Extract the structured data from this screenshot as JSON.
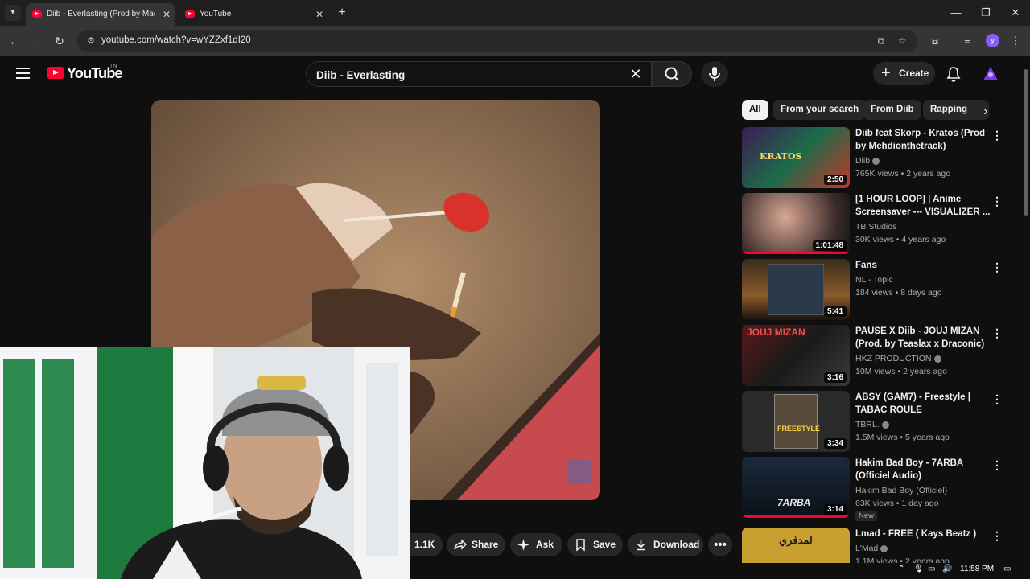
{
  "browser": {
    "tabs": [
      {
        "title": "Diib - Everlasting (Prod by Mac",
        "active": true
      },
      {
        "title": "YouTube",
        "active": false
      }
    ],
    "url": "youtube.com/watch?v=wYZZxf1dI20"
  },
  "header": {
    "logo_text": "YouTube",
    "logo_suffix": "TN",
    "search_value": "Diib - Everlasting",
    "create_label": "Create"
  },
  "actions": {
    "likes": "1.1K",
    "share": "Share",
    "ask": "Ask",
    "save": "Save",
    "download": "Download"
  },
  "chips": [
    "All",
    "From your search",
    "From Diib",
    "Rapping"
  ],
  "recommendations": [
    {
      "title": "Diib feat Skorp - Kratos (Prod by Mehdionthetrack)",
      "channel": "Diib",
      "verified": true,
      "meta": "765K views • 2 years ago",
      "duration": "2:50",
      "thumb_text": "KRATOS"
    },
    {
      "title": "[1 HOUR LOOP] | Anime Screensaver --- VISUALIZER ...",
      "channel": "TB Studios",
      "verified": false,
      "meta": "30K views • 4 years ago",
      "duration": "1:01:48"
    },
    {
      "title": "Fans",
      "channel": "NL - Topic",
      "verified": false,
      "meta": "184 views • 8 days ago",
      "duration": "5:41"
    },
    {
      "title": "PAUSE X Diib - JOUJ MIZAN (Prod. by Teaslax x Draconic)",
      "channel": "HKZ PRODUCTION",
      "verified": true,
      "meta": "10M views • 2 years ago",
      "duration": "3:16",
      "thumb_text": "JOUJ MIZAN"
    },
    {
      "title": "ABSY (GAM7) - Freestyle | TABAC ROULE",
      "channel": "TBRL.",
      "verified": true,
      "meta": "1.5M views • 5 years ago",
      "duration": "3:34",
      "thumb_text": "FREESTYLE"
    },
    {
      "title": "Hakim Bad Boy -  7ARBA (Officiel Audio)",
      "channel": "Hakim Bad Boy (Officiel)",
      "verified": false,
      "meta": "63K views • 1 day ago",
      "duration": "3:14",
      "badge": "New",
      "thumb_text": "7ARBA"
    },
    {
      "title": "Lmad - FREE  ( Kays Beatz )",
      "channel": "L'Mad",
      "verified": true,
      "meta": "1.1M views • 2 years ago",
      "duration": "",
      "thumb_text": "لمدفري"
    }
  ],
  "taskbar": {
    "time": "11:58 PM"
  },
  "colors": {
    "bg": "#0f0f0f",
    "accent": "#ff0033",
    "chip": "#272727"
  }
}
